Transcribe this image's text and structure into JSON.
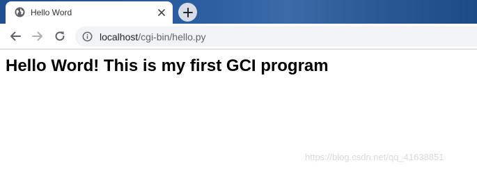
{
  "tab": {
    "title": "Hello Word",
    "favicon": "globe-icon",
    "close_icon": "close-icon"
  },
  "new_tab_icon": "plus-icon",
  "nav": {
    "back_icon": "arrow-left-icon",
    "forward_icon": "arrow-right-icon",
    "reload_icon": "reload-icon"
  },
  "address": {
    "info_icon": "info-icon",
    "host": "localhost",
    "path": "/cgi-bin/hello.py"
  },
  "page": {
    "heading": "Hello Word! This is my first GCI program"
  },
  "watermark": "https://blog.csdn.net/qq_41638851",
  "colors": {
    "tabstrip": "#2a5d9f",
    "omnibox": "#f1f3f4",
    "text": "#000000"
  }
}
